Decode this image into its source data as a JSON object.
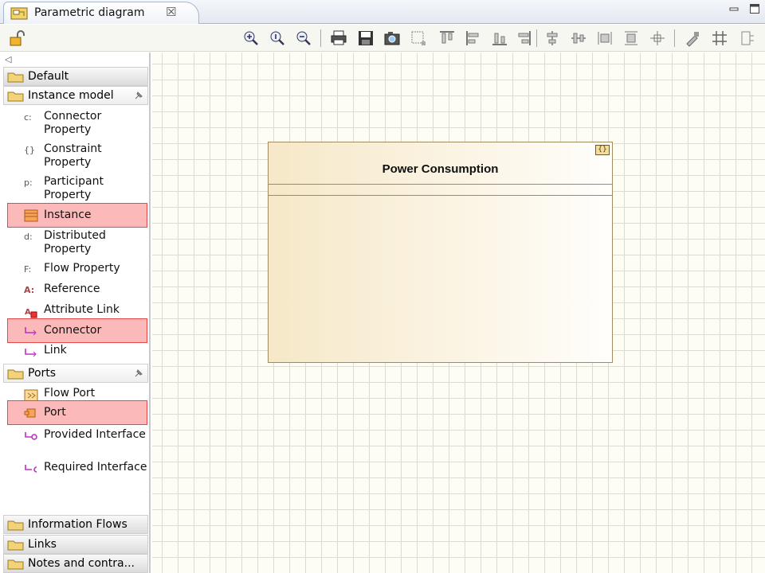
{
  "tab": {
    "title": "Parametric diagram",
    "close": "☒"
  },
  "palette": {
    "drawers": {
      "default": "Default",
      "instance_model": "Instance model",
      "ports": "Ports",
      "information_flows": "Information Flows",
      "links": "Links",
      "notes": "Notes and contra..."
    },
    "instance_items": [
      {
        "icon": "c:",
        "label": "Connector Property"
      },
      {
        "icon": "{}",
        "label": "Constraint Property"
      },
      {
        "icon": "p:",
        "label": "Participant Property"
      },
      {
        "icon": "instance-icon",
        "label": "Instance"
      },
      {
        "icon": "d:",
        "label": "Distributed Property"
      },
      {
        "icon": "F:",
        "label": "Flow Property"
      },
      {
        "icon": "A:",
        "label": "Reference"
      },
      {
        "icon": "attribute-link-icon",
        "label": "Attribute Link"
      },
      {
        "icon": "connector-icon",
        "label": "Connector"
      },
      {
        "icon": "link-icon",
        "label": "Link"
      }
    ],
    "port_items": [
      {
        "icon": "flow-port-icon",
        "label": "Flow Port"
      },
      {
        "icon": "port-icon",
        "label": "Port"
      },
      {
        "icon": "provided-interface-icon",
        "label": "Provided Interface"
      },
      {
        "icon": "required-interface-icon",
        "label": "Required Interface"
      }
    ]
  },
  "canvas": {
    "block": {
      "name": "Power Consumption",
      "stereotype_icon": "{}"
    }
  },
  "colors": {
    "selection": "#fbb9b9",
    "selection_border": "#e54848",
    "block_fill": "#f6e8c8"
  }
}
